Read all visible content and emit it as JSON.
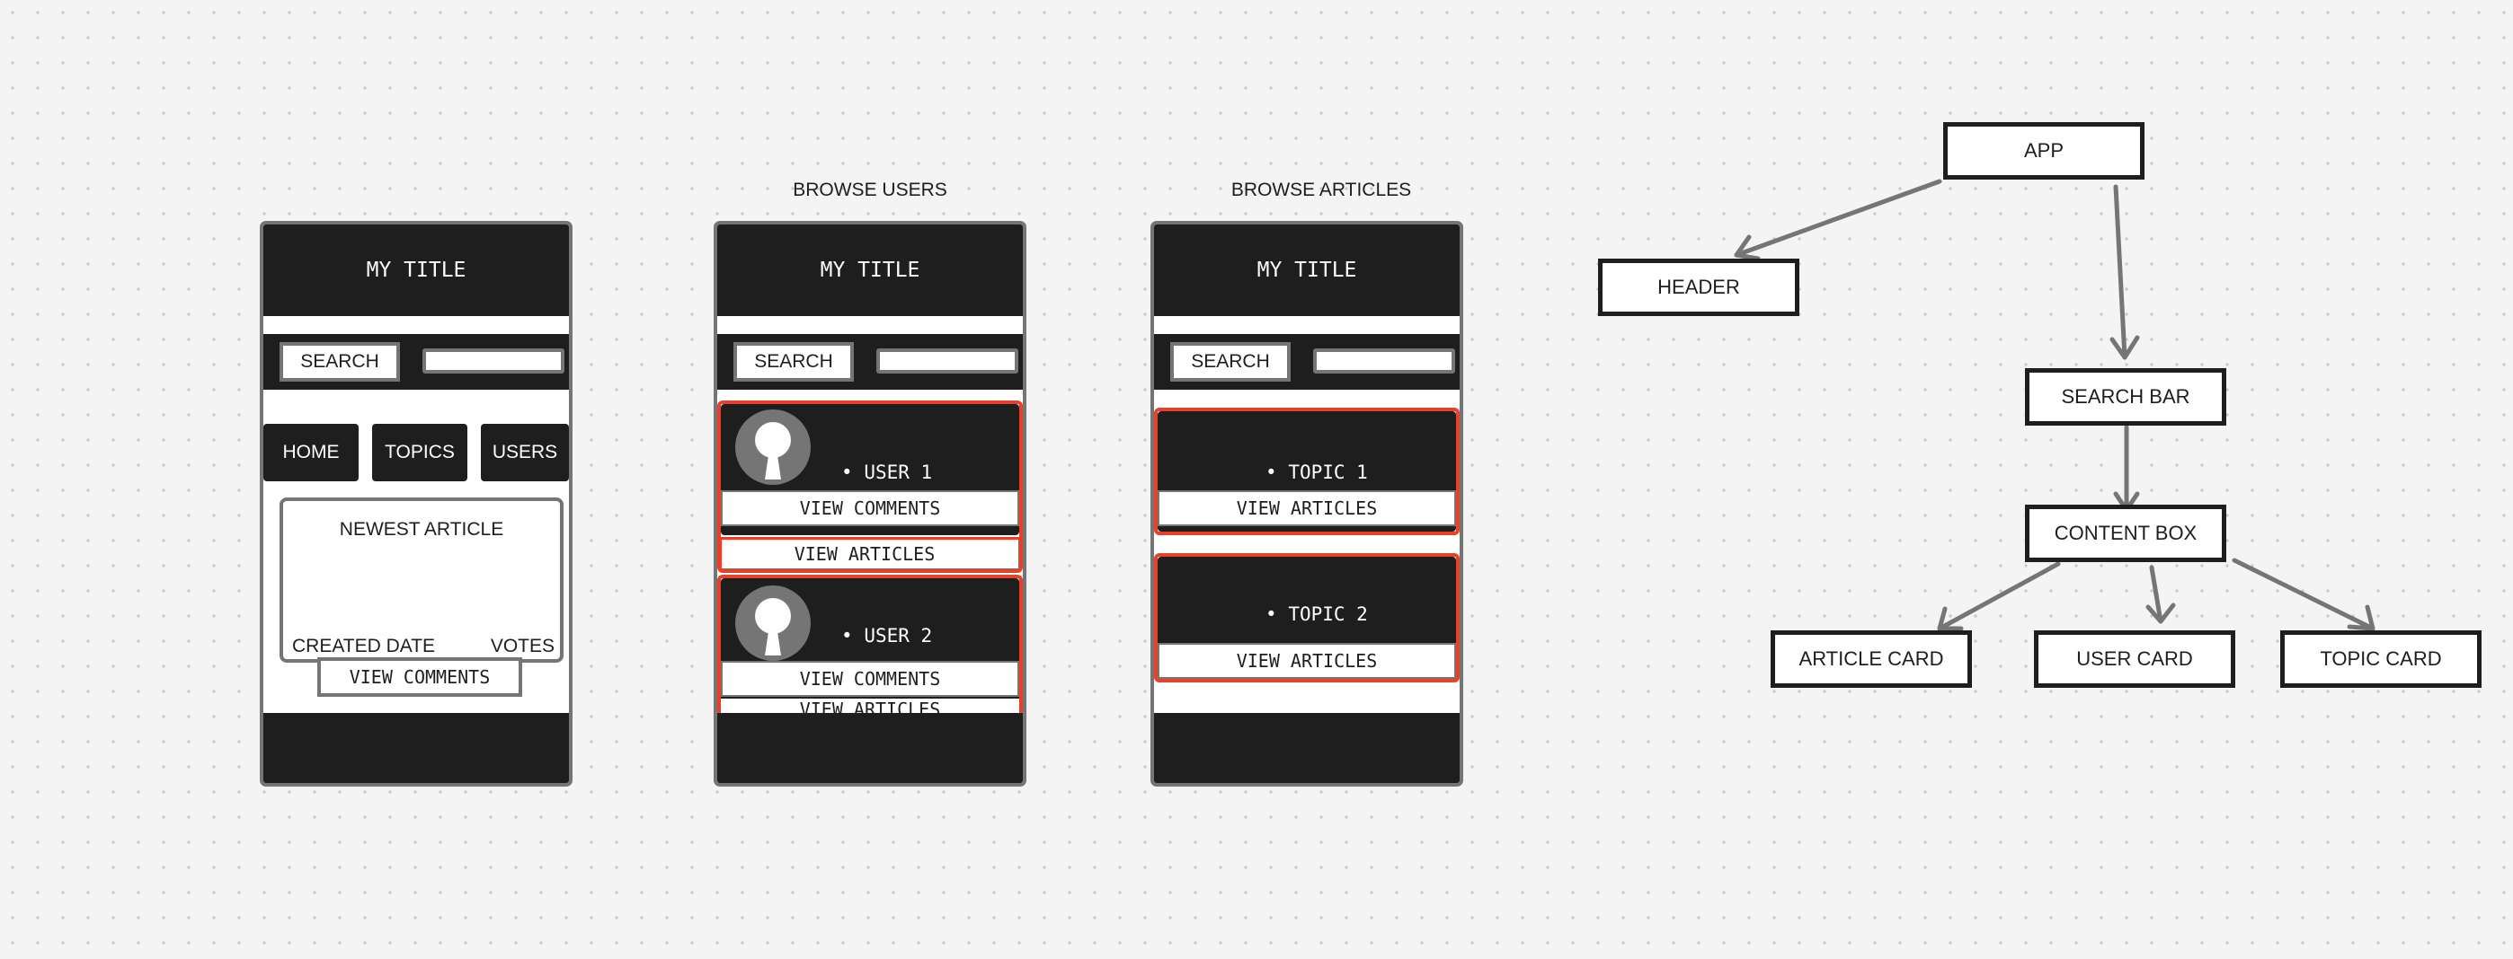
{
  "captions": {
    "browse_users": "BROWSE USERS",
    "browse_articles": "BROWSE ARTICLES"
  },
  "wireframe_home": {
    "title": "MY TITLE",
    "search_label": "SEARCH",
    "nav": [
      "HOME",
      "TOPICS",
      "USERS"
    ],
    "article_card": {
      "heading": "NEWEST ARTICLE",
      "created": "CREATED DATE",
      "votes": "VOTES",
      "button": "VIEW COMMENTS"
    }
  },
  "wireframe_users": {
    "title": "MY TITLE",
    "search_label": "SEARCH",
    "users": [
      {
        "label": "USER 1",
        "comments_button": "VIEW COMMENTS",
        "articles_button": "VIEW ARTICLES"
      },
      {
        "label": "USER 2",
        "comments_button": "VIEW COMMENTS",
        "articles_button": "VIEW ARTICLES"
      }
    ]
  },
  "wireframe_articles": {
    "title": "MY TITLE",
    "search_label": "SEARCH",
    "topics": [
      {
        "label": "TOPIC 1",
        "button": "VIEW ARTICLES"
      },
      {
        "label": "TOPIC 2",
        "button": "VIEW ARTICLES"
      }
    ]
  },
  "component_tree": {
    "nodes": {
      "app": "APP",
      "header": "HEADER",
      "search_bar": "SEARCH BAR",
      "content_box": "CONTENT BOX",
      "article_card": "ARTICLE CARD",
      "user_card": "USER CARD",
      "topic_card": "TOPIC CARD"
    },
    "edges": [
      [
        "app",
        "header"
      ],
      [
        "app",
        "search_bar"
      ],
      [
        "search_bar",
        "content_box"
      ],
      [
        "content_box",
        "article_card"
      ],
      [
        "content_box",
        "user_card"
      ],
      [
        "content_box",
        "topic_card"
      ]
    ]
  },
  "colors": {
    "dark": "#1e1e1e",
    "gray": "#757575",
    "highlight": "#e8412a",
    "arrow": "#757575"
  }
}
